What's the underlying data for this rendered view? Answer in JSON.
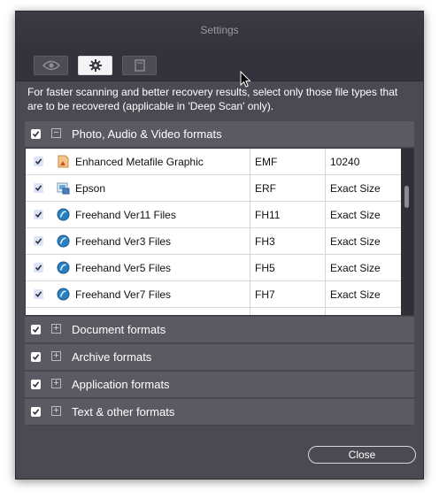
{
  "window": {
    "title": "Settings"
  },
  "toolbar": {
    "buttons": [
      {
        "icon": "eye-icon",
        "active": false
      },
      {
        "icon": "gear-icon",
        "active": true
      },
      {
        "icon": "document-icon",
        "active": false
      }
    ]
  },
  "info_text": "For faster scanning and better recovery results, select only those file types that are to be recovered (applicable in 'Deep Scan' only).",
  "categories": [
    {
      "label": "Photo, Audio & Video formats",
      "checked": true,
      "expanded": true
    },
    {
      "label": "Document formats",
      "checked": true,
      "expanded": false
    },
    {
      "label": "Archive formats",
      "checked": true,
      "expanded": false
    },
    {
      "label": "Application formats",
      "checked": true,
      "expanded": false
    },
    {
      "label": "Text & other formats",
      "checked": true,
      "expanded": false
    }
  ],
  "file_types": [
    {
      "name": "Enhanced Metafile Graphic",
      "ext": "EMF",
      "size": "10240",
      "checked": true,
      "icon": "image-file-icon"
    },
    {
      "name": "Epson",
      "ext": "ERF",
      "size": "Exact Size",
      "checked": true,
      "icon": "photo-file-icon"
    },
    {
      "name": "Freehand Ver11 Files",
      "ext": "FH11",
      "size": "Exact Size",
      "checked": true,
      "icon": "freehand-icon"
    },
    {
      "name": "Freehand Ver3 Files",
      "ext": "FH3",
      "size": "Exact Size",
      "checked": true,
      "icon": "freehand-icon"
    },
    {
      "name": "Freehand Ver5 Files",
      "ext": "FH5",
      "size": "Exact Size",
      "checked": true,
      "icon": "freehand-icon"
    },
    {
      "name": "Freehand Ver7 Files",
      "ext": "FH7",
      "size": "Exact Size",
      "checked": true,
      "icon": "freehand-icon"
    }
  ],
  "close_label": "Close",
  "colors": {
    "window_bg": "#4b4a52",
    "category_bg": "#5b5a62",
    "accent": "#2a7fc0"
  }
}
